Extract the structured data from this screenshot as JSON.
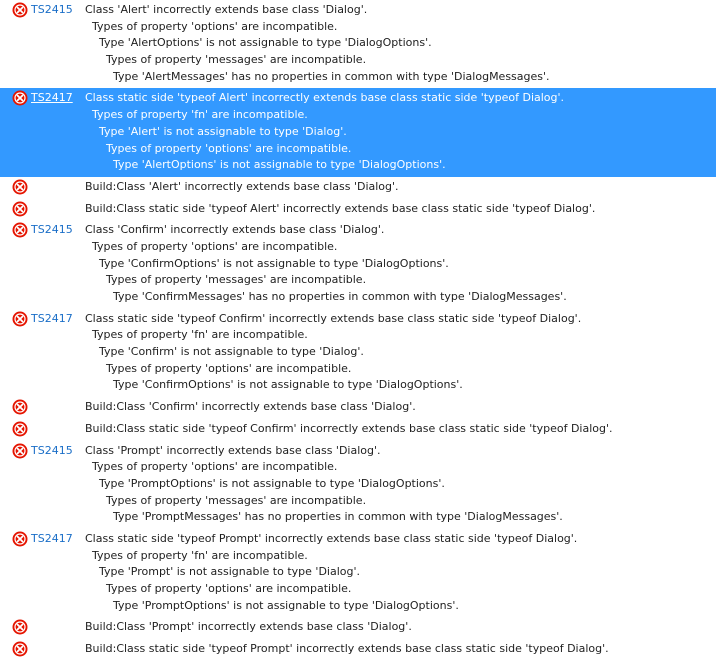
{
  "errors": [
    {
      "code": "TS2415",
      "selected": false,
      "lines": [
        "Class 'Alert' incorrectly extends base class 'Dialog'.",
        "  Types of property 'options' are incompatible.",
        "    Type 'AlertOptions' is not assignable to type 'DialogOptions'.",
        "      Types of property 'messages' are incompatible.",
        "        Type 'AlertMessages' has no properties in common with type 'DialogMessages'."
      ]
    },
    {
      "code": "TS2417",
      "selected": true,
      "lines": [
        "Class static side 'typeof Alert' incorrectly extends base class static side 'typeof Dialog'.",
        "  Types of property 'fn' are incompatible.",
        "    Type 'Alert' is not assignable to type 'Dialog'.",
        "      Types of property 'options' are incompatible.",
        "        Type 'AlertOptions' is not assignable to type 'DialogOptions'."
      ]
    },
    {
      "code": "",
      "selected": false,
      "lines": [
        "Build:Class 'Alert' incorrectly extends base class 'Dialog'."
      ]
    },
    {
      "code": "",
      "selected": false,
      "lines": [
        "Build:Class static side 'typeof Alert' incorrectly extends base class static side 'typeof Dialog'."
      ]
    },
    {
      "code": "TS2415",
      "selected": false,
      "lines": [
        "Class 'Confirm' incorrectly extends base class 'Dialog'.",
        "  Types of property 'options' are incompatible.",
        "    Type 'ConfirmOptions' is not assignable to type 'DialogOptions'.",
        "      Types of property 'messages' are incompatible.",
        "        Type 'ConfirmMessages' has no properties in common with type 'DialogMessages'."
      ]
    },
    {
      "code": "TS2417",
      "selected": false,
      "lines": [
        "Class static side 'typeof Confirm' incorrectly extends base class static side 'typeof Dialog'.",
        "  Types of property 'fn' are incompatible.",
        "    Type 'Confirm' is not assignable to type 'Dialog'.",
        "      Types of property 'options' are incompatible.",
        "        Type 'ConfirmOptions' is not assignable to type 'DialogOptions'."
      ]
    },
    {
      "code": "",
      "selected": false,
      "lines": [
        "Build:Class 'Confirm' incorrectly extends base class 'Dialog'."
      ]
    },
    {
      "code": "",
      "selected": false,
      "lines": [
        "Build:Class static side 'typeof Confirm' incorrectly extends base class static side 'typeof Dialog'."
      ]
    },
    {
      "code": "TS2415",
      "selected": false,
      "lines": [
        "Class 'Prompt' incorrectly extends base class 'Dialog'.",
        "  Types of property 'options' are incompatible.",
        "    Type 'PromptOptions' is not assignable to type 'DialogOptions'.",
        "      Types of property 'messages' are incompatible.",
        "        Type 'PromptMessages' has no properties in common with type 'DialogMessages'."
      ]
    },
    {
      "code": "TS2417",
      "selected": false,
      "lines": [
        "Class static side 'typeof Prompt' incorrectly extends base class static side 'typeof Dialog'.",
        "  Types of property 'fn' are incompatible.",
        "    Type 'Prompt' is not assignable to type 'Dialog'.",
        "      Types of property 'options' are incompatible.",
        "        Type 'PromptOptions' is not assignable to type 'DialogOptions'."
      ]
    },
    {
      "code": "",
      "selected": false,
      "lines": [
        "Build:Class 'Prompt' incorrectly extends base class 'Dialog'."
      ]
    },
    {
      "code": "",
      "selected": false,
      "lines": [
        "Build:Class static side 'typeof Prompt' incorrectly extends base class static side 'typeof Dialog'."
      ]
    }
  ],
  "icons": {
    "error_icon": "error-icon",
    "error_color": "#e51400"
  }
}
